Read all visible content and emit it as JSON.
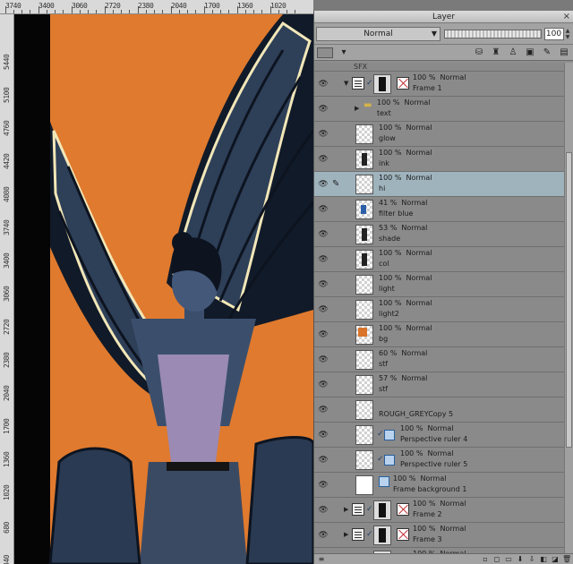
{
  "ruler_top": [
    "3740",
    "3400",
    "3060",
    "2720",
    "2380",
    "2040",
    "1700",
    "1360",
    "1020"
  ],
  "ruler_left": [
    "5440",
    "5100",
    "4760",
    "4420",
    "4080",
    "3740",
    "3400",
    "3060",
    "2720",
    "2380",
    "2040",
    "1700",
    "1360",
    "1020",
    "680",
    "340"
  ],
  "panel": {
    "title": "Layer",
    "blend_mode": "Normal",
    "opacity": "100"
  },
  "sfx_label": "SFX",
  "layers": [
    {
      "opacity": "100 %",
      "mode": "Normal",
      "name": "Frame 1",
      "kind": "frame",
      "expanded": true,
      "visible": true
    },
    {
      "opacity": "100 %",
      "mode": "Normal",
      "name": "text",
      "kind": "folder",
      "visible": true
    },
    {
      "opacity": "100 %",
      "mode": "Normal",
      "name": "glow",
      "kind": "raster",
      "visible": true
    },
    {
      "opacity": "100 %",
      "mode": "Normal",
      "name": "ink",
      "kind": "raster-black",
      "visible": true
    },
    {
      "opacity": "100 %",
      "mode": "Normal",
      "name": "hi",
      "kind": "raster",
      "visible": true,
      "selected": true
    },
    {
      "opacity": "41 %",
      "mode": "Normal",
      "name": "filter blue",
      "kind": "raster-blue",
      "visible": true
    },
    {
      "opacity": "53 %",
      "mode": "Normal",
      "name": "shade",
      "kind": "raster-black",
      "visible": true
    },
    {
      "opacity": "100 %",
      "mode": "Normal",
      "name": "col",
      "kind": "raster-black",
      "visible": true
    },
    {
      "opacity": "100 %",
      "mode": "Normal",
      "name": "light",
      "kind": "raster",
      "visible": true
    },
    {
      "opacity": "100 %",
      "mode": "Normal",
      "name": "light2",
      "kind": "raster",
      "visible": true
    },
    {
      "opacity": "100 %",
      "mode": "Normal",
      "name": "bg",
      "kind": "raster-orange",
      "visible": true
    },
    {
      "opacity": "60 %",
      "mode": "Normal",
      "name": "stf",
      "kind": "raster",
      "visible": true
    },
    {
      "opacity": "57 %",
      "mode": "Normal",
      "name": "stf",
      "kind": "raster",
      "visible": true
    },
    {
      "opacity": "",
      "mode": "",
      "name": "ROUGH_GREYCopy 5",
      "kind": "raster-single",
      "visible": true
    },
    {
      "opacity": "100 %",
      "mode": "Normal",
      "name": "Perspective ruler 4",
      "kind": "ruler",
      "visible": true
    },
    {
      "opacity": "100 %",
      "mode": "Normal",
      "name": "Perspective ruler 5",
      "kind": "ruler",
      "visible": true
    },
    {
      "opacity": "100 %",
      "mode": "Normal",
      "name": "Frame background 1",
      "kind": "frame-bg",
      "visible": true
    },
    {
      "opacity": "100 %",
      "mode": "Normal",
      "name": "Frame 2",
      "kind": "frame",
      "expanded": false,
      "visible": true
    },
    {
      "opacity": "100 %",
      "mode": "Normal",
      "name": "Frame 3",
      "kind": "frame",
      "expanded": false,
      "visible": true
    },
    {
      "opacity": "100 %",
      "mode": "Normal",
      "name": "",
      "kind": "frame",
      "expanded": false,
      "visible": true
    }
  ],
  "colors": {
    "canvas_bg": "#e07a2e",
    "selected_row": "#9fb3bd",
    "panel_bg": "#8e8e8e"
  }
}
